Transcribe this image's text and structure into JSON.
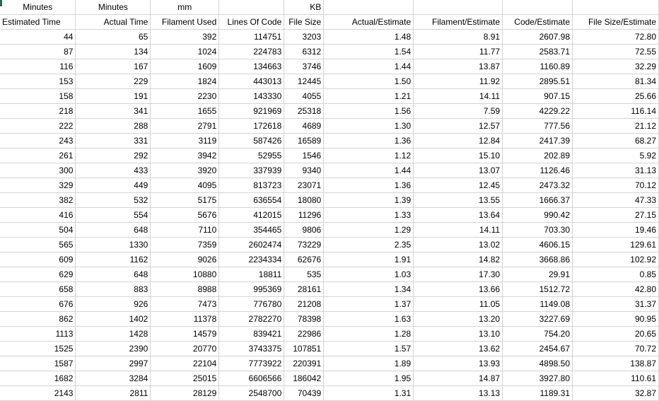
{
  "header_row1": [
    "Minutes",
    "Minutes",
    "mm",
    "",
    "KB",
    "",
    "",
    "",
    ""
  ],
  "header_row2": [
    "Estimated Time",
    "Actual Time",
    "Filament Used",
    "Lines Of Code",
    "File Size",
    "Actual/Estimate",
    "Filament/Estimate",
    "Code/Estimate",
    "File Size/Estimate"
  ],
  "rows": [
    [
      "44",
      "65",
      "392",
      "114751",
      "3203",
      "1.48",
      "8.91",
      "2607.98",
      "72.80"
    ],
    [
      "87",
      "134",
      "1024",
      "224783",
      "6312",
      "1.54",
      "11.77",
      "2583.71",
      "72.55"
    ],
    [
      "116",
      "167",
      "1609",
      "134663",
      "3746",
      "1.44",
      "13.87",
      "1160.89",
      "32.29"
    ],
    [
      "153",
      "229",
      "1824",
      "443013",
      "12445",
      "1.50",
      "11.92",
      "2895.51",
      "81.34"
    ],
    [
      "158",
      "191",
      "2230",
      "143330",
      "4055",
      "1.21",
      "14.11",
      "907.15",
      "25.66"
    ],
    [
      "218",
      "341",
      "1655",
      "921969",
      "25318",
      "1.56",
      "7.59",
      "4229.22",
      "116.14"
    ],
    [
      "222",
      "288",
      "2791",
      "172618",
      "4689",
      "1.30",
      "12.57",
      "777.56",
      "21.12"
    ],
    [
      "243",
      "331",
      "3119",
      "587426",
      "16589",
      "1.36",
      "12.84",
      "2417.39",
      "68.27"
    ],
    [
      "261",
      "292",
      "3942",
      "52955",
      "1546",
      "1.12",
      "15.10",
      "202.89",
      "5.92"
    ],
    [
      "300",
      "433",
      "3920",
      "337939",
      "9340",
      "1.44",
      "13.07",
      "1126.46",
      "31.13"
    ],
    [
      "329",
      "449",
      "4095",
      "813723",
      "23071",
      "1.36",
      "12.45",
      "2473.32",
      "70.12"
    ],
    [
      "382",
      "532",
      "5175",
      "636554",
      "18080",
      "1.39",
      "13.55",
      "1666.37",
      "47.33"
    ],
    [
      "416",
      "554",
      "5676",
      "412015",
      "11296",
      "1.33",
      "13.64",
      "990.42",
      "27.15"
    ],
    [
      "504",
      "648",
      "7110",
      "354465",
      "9806",
      "1.29",
      "14.11",
      "703.30",
      "19.46"
    ],
    [
      "565",
      "1330",
      "7359",
      "2602474",
      "73229",
      "2.35",
      "13.02",
      "4606.15",
      "129.61"
    ],
    [
      "609",
      "1162",
      "9026",
      "2234334",
      "62676",
      "1.91",
      "14.82",
      "3668.86",
      "102.92"
    ],
    [
      "629",
      "648",
      "10880",
      "18811",
      "535",
      "1.03",
      "17.30",
      "29.91",
      "0.85"
    ],
    [
      "658",
      "883",
      "8988",
      "995369",
      "28161",
      "1.34",
      "13.66",
      "1512.72",
      "42.80"
    ],
    [
      "676",
      "926",
      "7473",
      "776780",
      "21208",
      "1.37",
      "11.05",
      "1149.08",
      "31.37"
    ],
    [
      "862",
      "1402",
      "11378",
      "2782270",
      "78398",
      "1.63",
      "13.20",
      "3227.69",
      "90.95"
    ],
    [
      "1113",
      "1428",
      "14579",
      "839421",
      "22986",
      "1.28",
      "13.10",
      "754.20",
      "20.65"
    ],
    [
      "1525",
      "2390",
      "20770",
      "3743375",
      "107851",
      "1.57",
      "13.62",
      "2454.67",
      "70.72"
    ],
    [
      "1587",
      "2997",
      "22104",
      "7773922",
      "220391",
      "1.89",
      "13.93",
      "4898.50",
      "138.87"
    ],
    [
      "1682",
      "3284",
      "25015",
      "6606566",
      "186042",
      "1.95",
      "14.87",
      "3927.80",
      "110.61"
    ],
    [
      "2143",
      "2811",
      "28129",
      "2548700",
      "70439",
      "1.31",
      "13.13",
      "1189.31",
      "32.87"
    ]
  ]
}
